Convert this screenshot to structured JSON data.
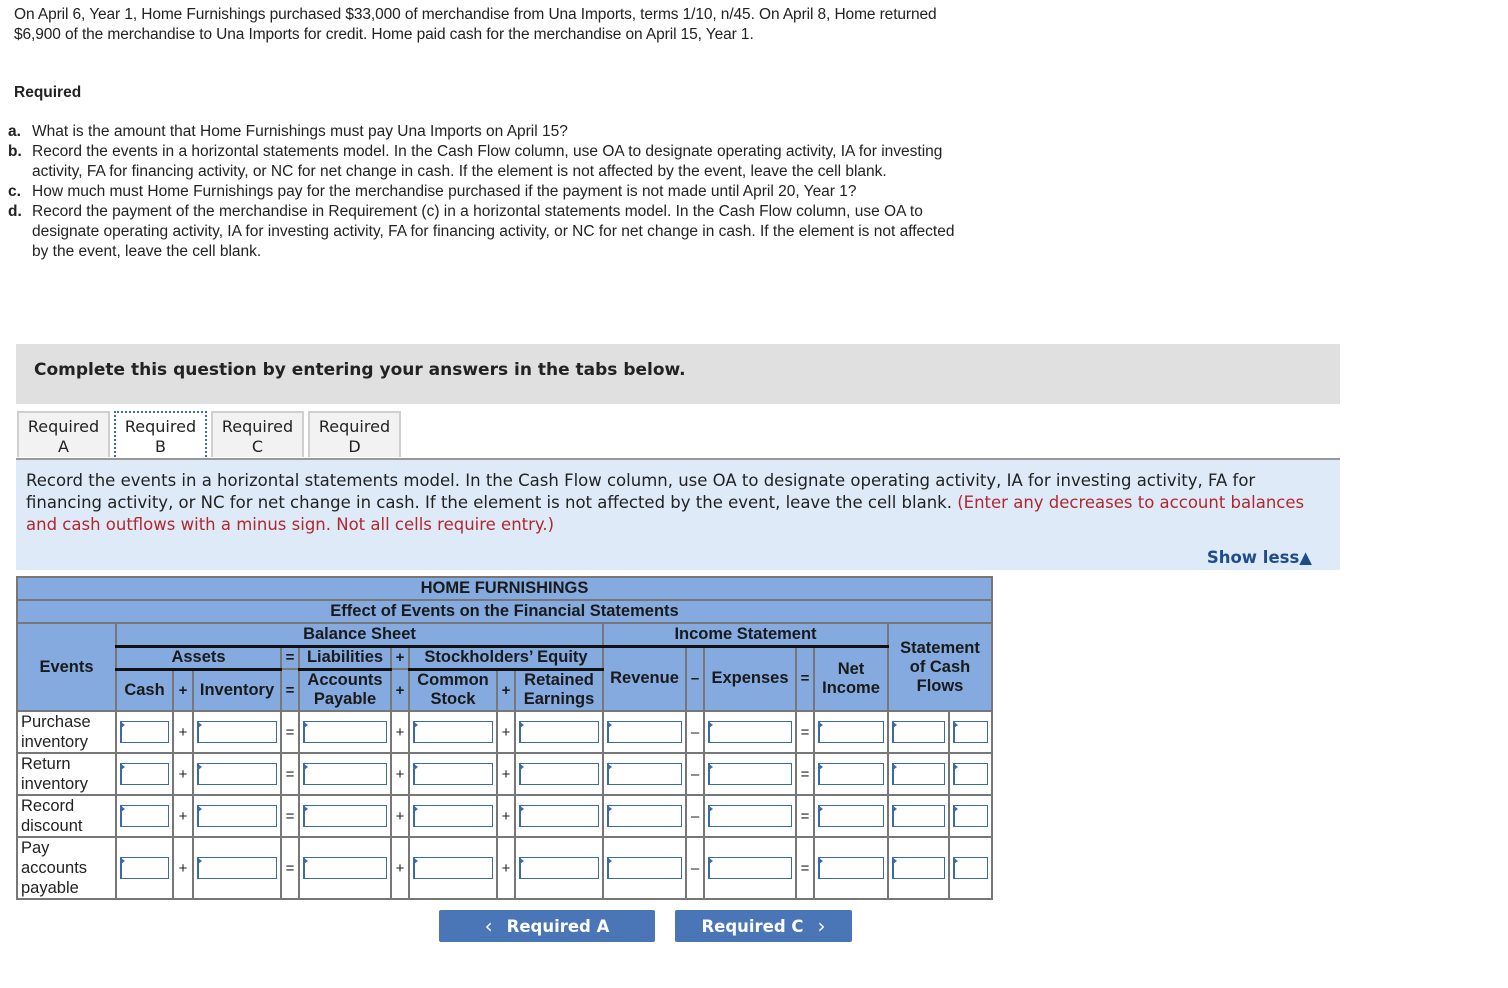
{
  "problem": {
    "intro": "On April 6, Year 1, Home Furnishings purchased $33,000 of merchandise from Una Imports, terms 1/10, n/45. On April 8, Home returned $6,900 of the merchandise to Una Imports for credit. Home paid cash for the merchandise on April 15, Year 1.",
    "required_title": "Required",
    "requirements": [
      {
        "label": "a.",
        "text": "What is the amount that Home Furnishings must pay Una Imports on April 15?"
      },
      {
        "label": "b.",
        "text": "Record the events in a horizontal statements model. In the Cash Flow column, use OA to designate operating activity, IA for investing activity, FA for financing activity, or NC for net change in cash. If the element is not affected by the event, leave the cell blank."
      },
      {
        "label": "c.",
        "text": "How much must Home Furnishings pay for the merchandise purchased if the payment is not made until April 20, Year 1?"
      },
      {
        "label": "d.",
        "text": "Record the payment of the merchandise in Requirement (c) in a horizontal statements model. In the Cash Flow column, use OA to designate operating activity, IA for investing activity, FA for financing activity, or NC for net change in cash. If the element is not affected by the event, leave the cell blank."
      }
    ]
  },
  "banner": "Complete this question by entering your answers in the tabs below.",
  "tabs": [
    {
      "line1": "Required",
      "line2": "A",
      "active": false
    },
    {
      "line1": "Required",
      "line2": "B",
      "active": true
    },
    {
      "line1": "Required",
      "line2": "C",
      "active": false
    },
    {
      "line1": "Required",
      "line2": "D",
      "active": false
    }
  ],
  "instructions": {
    "text": "Record the events in a horizontal statements model. In the Cash Flow column, use OA to designate operating activity, IA for investing activity, FA for financing activity, or NC for net change in cash. If the element is not affected by the event, leave the cell blank.",
    "note": "(Enter any decreases to account balances and cash outflows with a minus sign. Not all cells require entry.)",
    "show_less": "Show less",
    "show_less_icon": "▲"
  },
  "model": {
    "company": "HOME FURNISHINGS",
    "subtitle": "Effect of Events on the Financial Statements",
    "events_header": "Events",
    "balance_sheet": "Balance Sheet",
    "income_statement": "Income Statement",
    "cash_flows": "Statement of Cash Flows",
    "assets": "Assets",
    "liabilities": "Liabilities",
    "equity": "Stockholders’ Equity",
    "cols": {
      "cash": "Cash",
      "inventory": "Inventory",
      "accounts_payable": "Accounts Payable",
      "common_stock": "Common Stock",
      "retained_earnings": "Retained Earnings",
      "revenue": "Revenue",
      "expenses": "Expenses",
      "net_income": "Net Income"
    },
    "ops": {
      "plus": "+",
      "equals": "=",
      "minus": "–"
    },
    "rows": [
      {
        "event": "Purchase inventory",
        "cash": "",
        "inventory": "",
        "accounts_payable": "",
        "common_stock": "",
        "retained_earnings": "",
        "revenue": "",
        "expenses": "",
        "net_income": "",
        "cf_amount": "",
        "cf_type": ""
      },
      {
        "event": "Return inventory",
        "cash": "",
        "inventory": "",
        "accounts_payable": "",
        "common_stock": "",
        "retained_earnings": "",
        "revenue": "",
        "expenses": "",
        "net_income": "",
        "cf_amount": "",
        "cf_type": ""
      },
      {
        "event": "Record discount",
        "cash": "",
        "inventory": "",
        "accounts_payable": "",
        "common_stock": "",
        "retained_earnings": "",
        "revenue": "",
        "expenses": "",
        "net_income": "",
        "cf_amount": "",
        "cf_type": ""
      },
      {
        "event": "Pay accounts payable",
        "cash": "",
        "inventory": "",
        "accounts_payable": "",
        "common_stock": "",
        "retained_earnings": "",
        "revenue": "",
        "expenses": "",
        "net_income": "",
        "cf_amount": "",
        "cf_type": ""
      }
    ]
  },
  "nav": {
    "prev_label": "Required A",
    "prev_icon": "‹",
    "next_label": "Required C",
    "next_icon": "›"
  }
}
